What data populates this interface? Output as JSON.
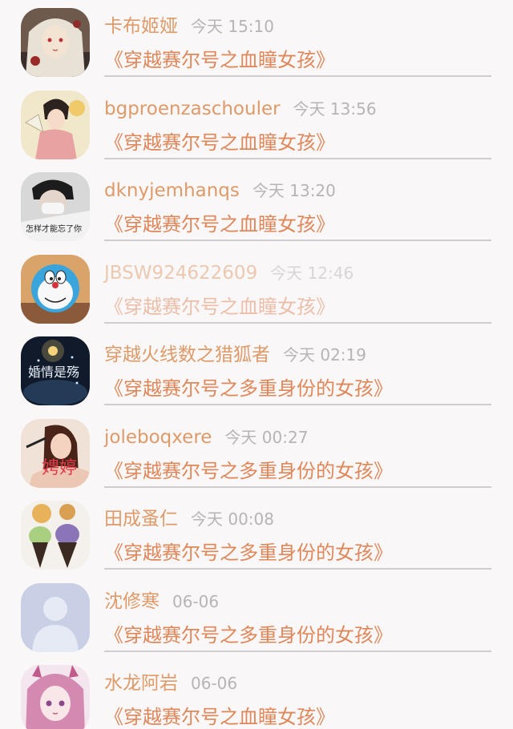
{
  "colors": {
    "background": "#f9f7f8",
    "name": "#de9a68",
    "title": "#e0875a",
    "time": "#b7b4b5",
    "divider": "#cfcdce"
  },
  "messages": [
    {
      "name": "卡布姬娅",
      "time": "今天 15:10",
      "title": "《穿越赛尔号之血瞳女孩》",
      "avatar": "anime-girl-avatar",
      "faded": false
    },
    {
      "name": "bgproenzaschouler",
      "time": "今天 13:56",
      "title": "《穿越赛尔号之血瞳女孩》",
      "avatar": "fan-lady-avatar",
      "faded": false
    },
    {
      "name": "dknyjemhanqs",
      "time": "今天 13:20",
      "title": "《穿越赛尔号之血瞳女孩》",
      "avatar": "masked-boy-avatar",
      "faded": false
    },
    {
      "name": "JBSW924622609",
      "time": "今天 12:46",
      "title": "《穿越赛尔号之血瞳女孩》",
      "avatar": "doraemon-avatar",
      "faded": true
    },
    {
      "name": "穿越火线数之猎狐者",
      "time": "今天 02:19",
      "title": "《穿越赛尔号之多重身份的女孩》",
      "avatar": "sparkle-text-avatar",
      "faded": false
    },
    {
      "name": "joleboqxere",
      "time": "今天 00:27",
      "title": "《穿越赛尔号之多重身份的女孩》",
      "avatar": "girl-photo-avatar",
      "faded": false
    },
    {
      "name": "田成蚤仁",
      "time": "今天 00:08",
      "title": "《穿越赛尔号之多重身份的女孩》",
      "avatar": "ice-cream-avatar",
      "faded": false
    },
    {
      "name": "沈修寒",
      "time": "06-06",
      "title": "《穿越赛尔号之多重身份的女孩》",
      "avatar": "default-user-avatar",
      "faded": false
    },
    {
      "name": "水龙阿岩",
      "time": "06-06",
      "title": "《穿越赛尔号之血瞳女孩》",
      "avatar": "pink-hair-girl-avatar",
      "faded": false
    }
  ]
}
